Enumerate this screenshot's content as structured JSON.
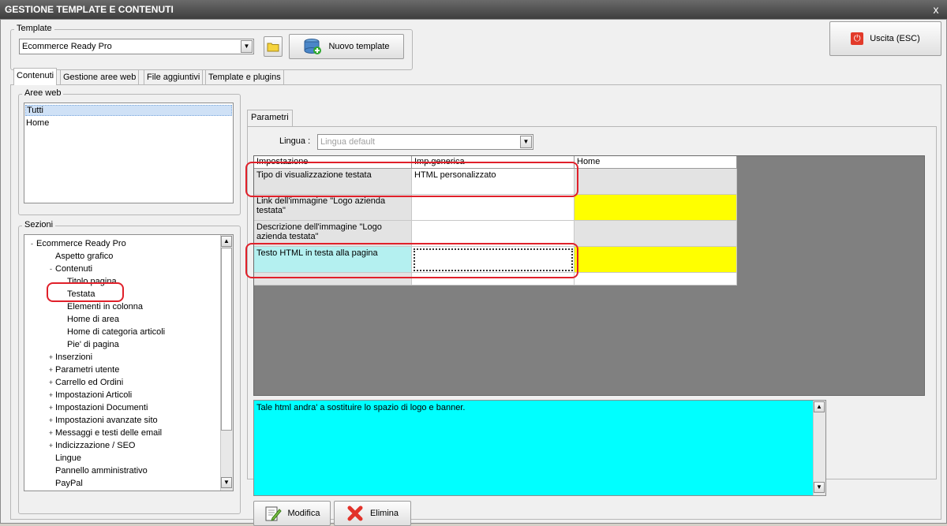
{
  "window": {
    "title": "GESTIONE TEMPLATE E CONTENUTI",
    "close": "x"
  },
  "template_group": {
    "legend": "Template",
    "selected": "Ecommerce Ready Pro",
    "new_template_label": "Nuovo template"
  },
  "exit_button": {
    "label": "Uscita (ESC)"
  },
  "tabs": [
    {
      "label": "Contenuti"
    },
    {
      "label": "Gestione aree web"
    },
    {
      "label": "File aggiuntivi"
    },
    {
      "label": "Template e plugins"
    }
  ],
  "aree_web": {
    "legend": "Aree web",
    "items": [
      "Tutti",
      "Home"
    ],
    "selected": "Tutti"
  },
  "sezioni": {
    "legend": "Sezioni",
    "items": [
      {
        "label": "Ecommerce Ready Pro",
        "level": 0,
        "expander": "-"
      },
      {
        "label": "Aspetto grafico",
        "level": 1,
        "expander": ""
      },
      {
        "label": "Contenuti",
        "level": 1,
        "expander": "-"
      },
      {
        "label": "Titolo pagina",
        "level": 2,
        "expander": ""
      },
      {
        "label": "Testata",
        "level": 2,
        "expander": ""
      },
      {
        "label": "Elementi in colonna",
        "level": 2,
        "expander": ""
      },
      {
        "label": "Home di area",
        "level": 2,
        "expander": ""
      },
      {
        "label": "Home di categoria articoli",
        "level": 2,
        "expander": ""
      },
      {
        "label": "Pie' di pagina",
        "level": 2,
        "expander": ""
      },
      {
        "label": "Inserzioni",
        "level": 1,
        "expander": "+"
      },
      {
        "label": "Parametri utente",
        "level": 1,
        "expander": "+"
      },
      {
        "label": "Carrello ed Ordini",
        "level": 1,
        "expander": "+"
      },
      {
        "label": "Impostazioni Articoli",
        "level": 1,
        "expander": "+"
      },
      {
        "label": "Impostazioni Documenti",
        "level": 1,
        "expander": "+"
      },
      {
        "label": "Impostazioni avanzate sito",
        "level": 1,
        "expander": "+"
      },
      {
        "label": "Messaggi e testi delle email",
        "level": 1,
        "expander": "+"
      },
      {
        "label": "Indicizzazione / SEO",
        "level": 1,
        "expander": "+"
      },
      {
        "label": "Lingue",
        "level": 1,
        "expander": ""
      },
      {
        "label": "Pannello amministrativo",
        "level": 1,
        "expander": ""
      },
      {
        "label": "PayPal",
        "level": 1,
        "expander": ""
      }
    ]
  },
  "parametri": {
    "tab_label": "Parametri",
    "lingua_label": "Lingua :",
    "lingua_value": "Lingua default",
    "columns": [
      "Impostazione",
      "Imp.generica",
      "Home"
    ],
    "rows": [
      {
        "name": "Tipo di visualizzazione testata",
        "generic": "HTML personalizzato",
        "home": ""
      },
      {
        "name": "Link dell'immagine \"Logo azienda testata\"",
        "generic": "",
        "home": ""
      },
      {
        "name": "Descrizione dell'immagine \"Logo azienda testata\"",
        "generic": "",
        "home": ""
      },
      {
        "name": "Testo HTML in testa alla pagina",
        "generic": "",
        "home": ""
      }
    ],
    "description": "Tale html andra' a sostituire lo spazio di logo e banner.",
    "colors": {
      "highlight_yellow": "#ffff00",
      "selected_row": "#b4f0f0",
      "description_bg": "#00ffff",
      "grid_gray": "#808080"
    }
  },
  "actions": {
    "modifica": "Modifica",
    "elimina": "Elimina"
  }
}
